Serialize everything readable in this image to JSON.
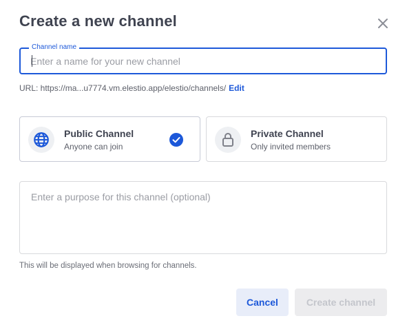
{
  "dialog": {
    "title": "Create a new channel",
    "close_icon": "close-icon"
  },
  "name_field": {
    "label": "Channel name",
    "value": "",
    "placeholder": "Enter a name for your new channel"
  },
  "url": {
    "prefix": "URL: https://ma...u7774.vm.elestio.app/elestio/channels/",
    "edit_label": "Edit"
  },
  "channel_types": [
    {
      "title": "Public Channel",
      "subtitle": "Anyone can join",
      "icon": "globe-icon",
      "selected": true
    },
    {
      "title": "Private Channel",
      "subtitle": "Only invited members",
      "icon": "lock-icon",
      "selected": false
    }
  ],
  "purpose": {
    "value": "",
    "placeholder": "Enter a purpose for this channel (optional)",
    "help": "This will be displayed when browsing for channels."
  },
  "buttons": {
    "cancel": "Cancel",
    "create": "Create channel"
  },
  "colors": {
    "accent": "#1c58d9",
    "text": "#3f4350",
    "disabled_bg": "#ececee",
    "disabled_text": "#c4c6cc"
  }
}
